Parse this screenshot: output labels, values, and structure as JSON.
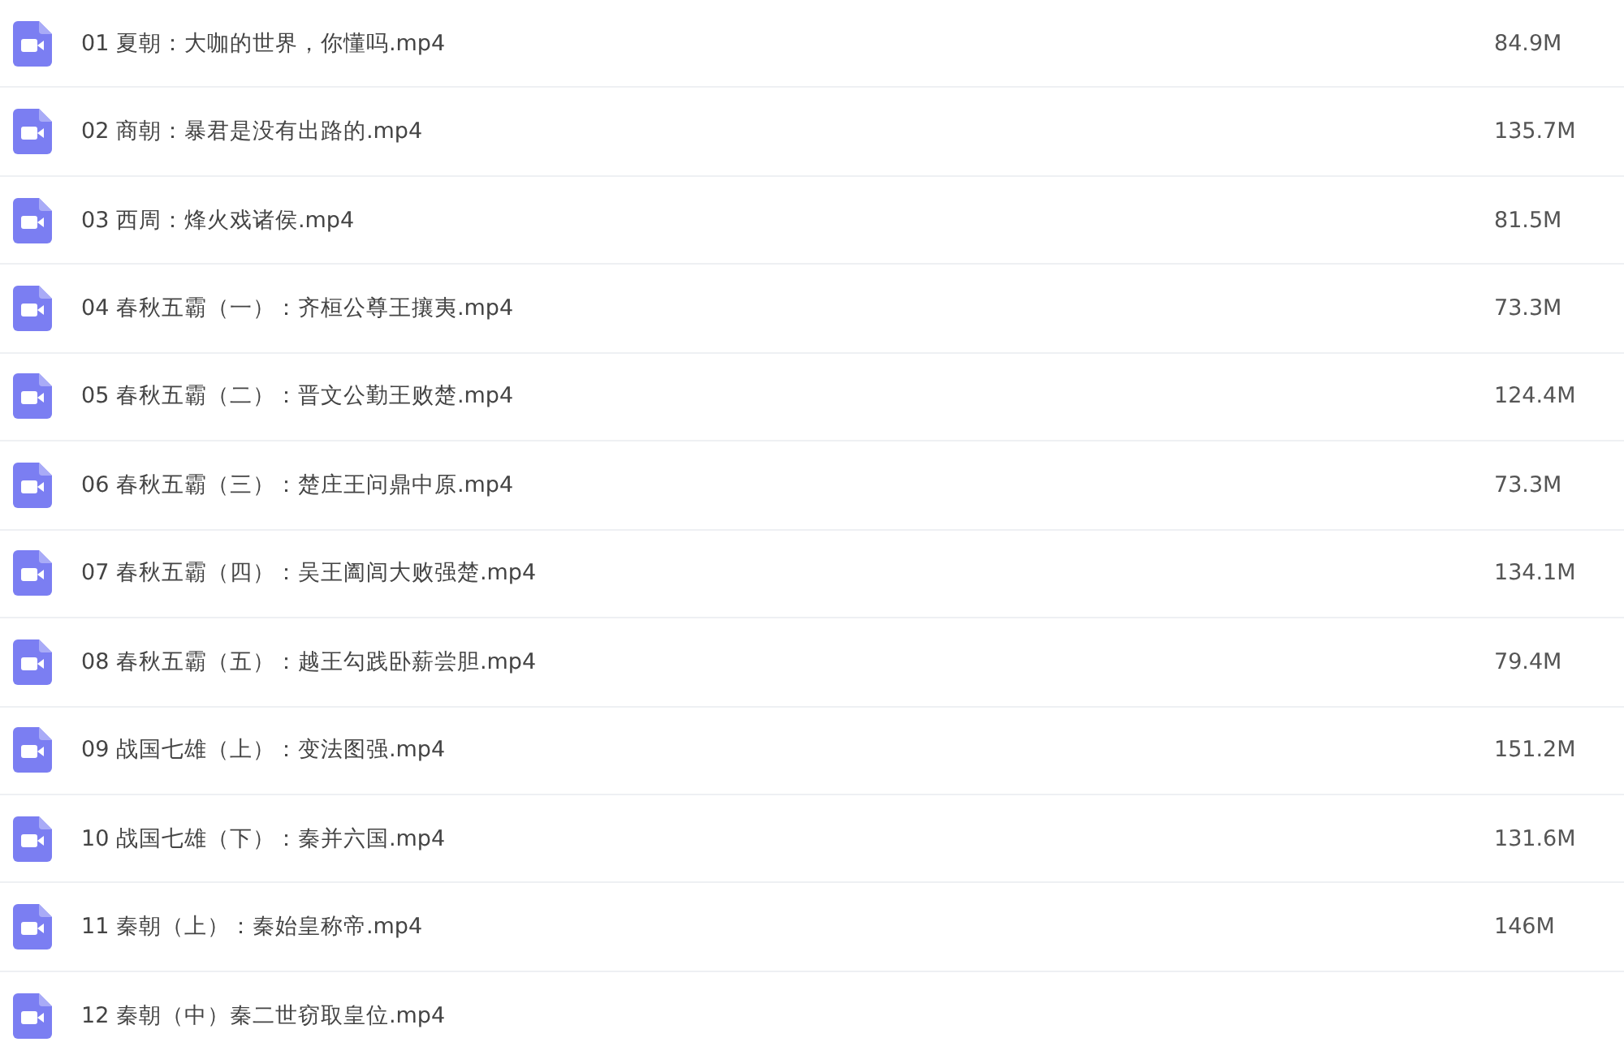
{
  "files": [
    {
      "name": "01 夏朝：大咖的世界，你懂吗.mp4",
      "size": "84.9M"
    },
    {
      "name": "02 商朝：暴君是没有出路的.mp4",
      "size": "135.7M"
    },
    {
      "name": "03 西周：烽火戏诸侯.mp4",
      "size": "81.5M"
    },
    {
      "name": "04 春秋五霸（一）：齐桓公尊王攘夷.mp4",
      "size": "73.3M"
    },
    {
      "name": "05 春秋五霸（二）：晋文公勤王败楚.mp4",
      "size": "124.4M"
    },
    {
      "name": "06 春秋五霸（三）：楚庄王问鼎中原.mp4",
      "size": "73.3M"
    },
    {
      "name": "07 春秋五霸（四）：吴王阖闾大败强楚.mp4",
      "size": "134.1M"
    },
    {
      "name": "08 春秋五霸（五）：越王勾践卧薪尝胆.mp4",
      "size": "79.4M"
    },
    {
      "name": "09 战国七雄（上）：变法图强.mp4",
      "size": "151.2M"
    },
    {
      "name": "10 战国七雄（下）：秦并六国.mp4",
      "size": "131.6M"
    },
    {
      "name": "11 秦朝（上）：秦始皇称帝.mp4",
      "size": "146M"
    },
    {
      "name": "12 秦朝（中）秦二世窃取皇位.mp4"
    }
  ]
}
